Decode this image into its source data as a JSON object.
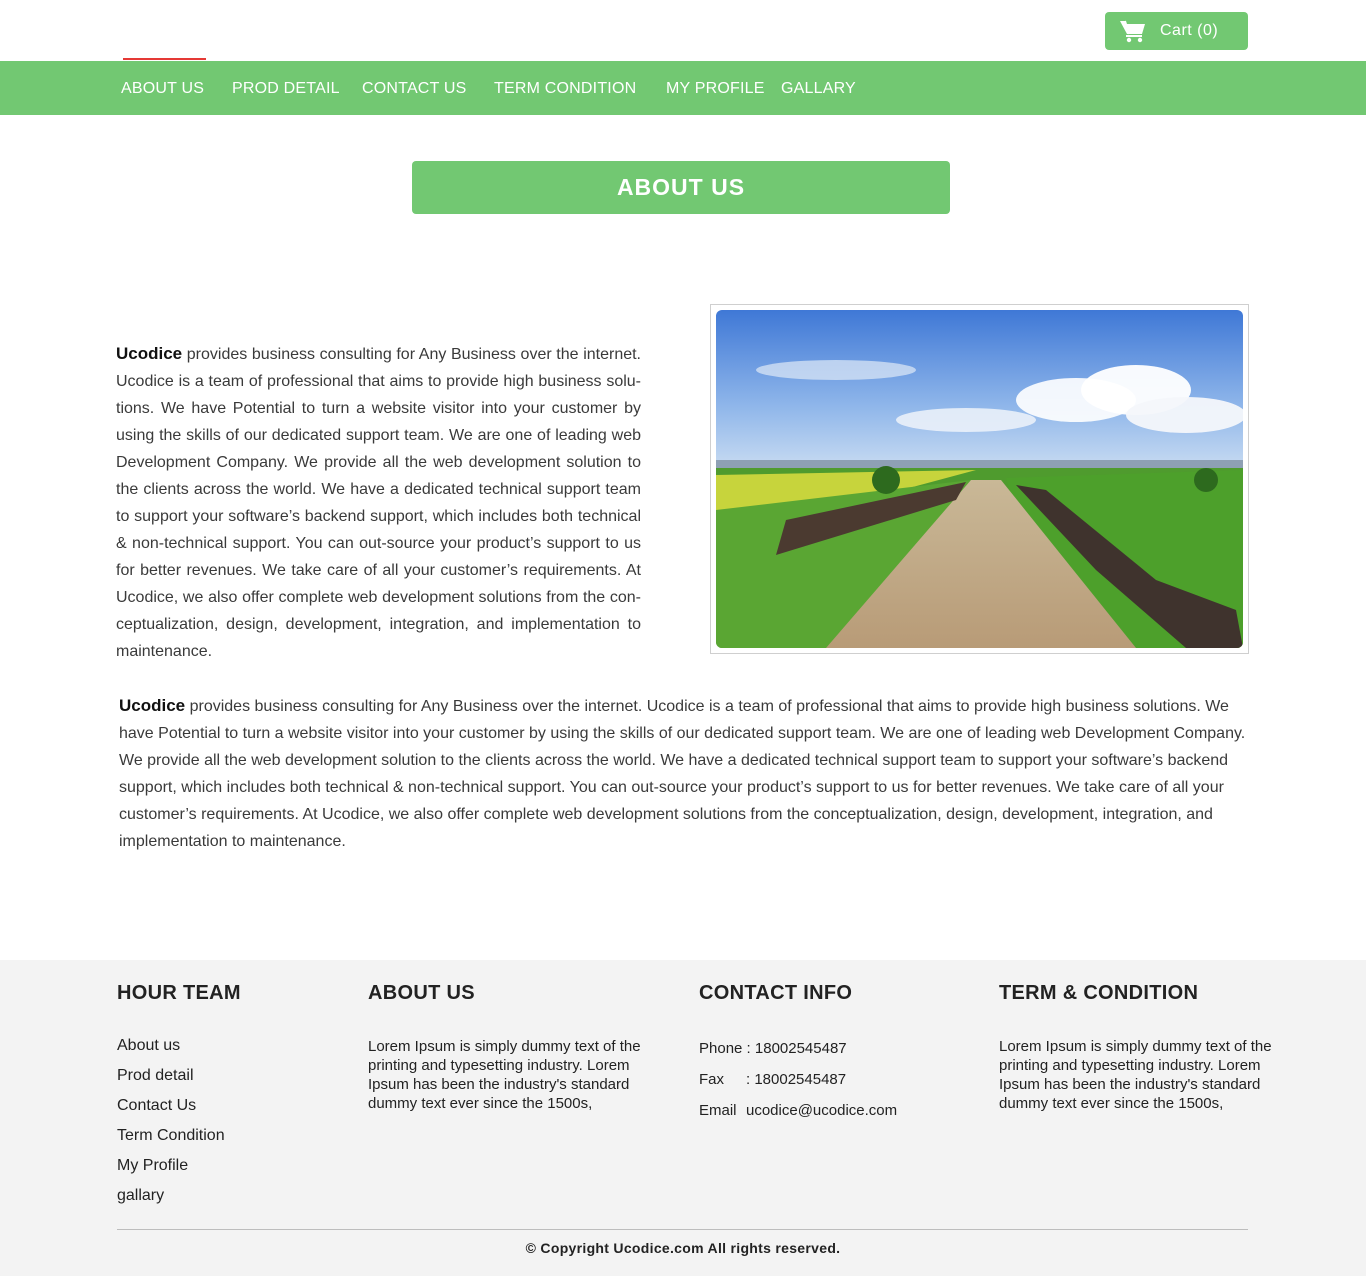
{
  "header": {
    "cart_label": "Cart (0)"
  },
  "nav": {
    "items": [
      "ABOUT US",
      "PROD DETAIL",
      "CONTACT US",
      "TERM CONDITION",
      "MY PROFILE",
      "GALLARY"
    ],
    "active_index": 0
  },
  "page": {
    "heading": "ABOUT US"
  },
  "content": {
    "brand": "Ucodice",
    "paragraph1": " provides business consulting for Any Business over the internet. Ucodice is a team of professional that aims to provide high business solu-tions. We have Potential to turn a website visitor into your customer by using the skills of our dedicated support team. We are one of leading web Development Company. We provide all the web development solution to the clients across the world.  We have a dedicated technical support team to support your software’s backend support, which includes both technical & non-technical support.  You can out-source your product’s support to us for better revenues. We take care of all your customer’s requirements.  At Ucodice, we also offer complete web development solutions from the con-ceptualization, design, development, integration, and implementation to maintenance.",
    "paragraph2": " provides business consulting for Any Business over the internet. Ucodice is a team of professional that aims to provide high business solutions. We have Potential to turn a website visitor into your customer by using the skills of our dedicated support team. We are one of leading web Development Company. We provide all the web development solution to the clients across the world.  We have a dedicated technical support team to support your software’s backend support, which includes both technical & non-technical support.  You can out-source your product’s support to us for better revenues. We take care of all your customer’s requirements.  At Ucodice, we also offer complete web development solutions from the conceptualization, design, development, integration, and implementation to maintenance."
  },
  "footer": {
    "team": {
      "title": "HOUR TEAM",
      "links": [
        "About us",
        "Prod detail",
        "Contact Us",
        "Term Condition",
        "My Profile",
        "gallary"
      ]
    },
    "about": {
      "title": "ABOUT US",
      "text": "Lorem Ipsum is simply dummy text of the printing and typesetting industry. Lorem Ipsum has been the industry's standard dummy text ever since the 1500s,"
    },
    "contact": {
      "title": "CONTACT INFO",
      "phone_label": "Phone",
      "phone": ": 18002545487",
      "fax_label": "Fax",
      "fax": ": 18002545487",
      "email_label": "Email",
      "email": "ucodice@ucodice.com"
    },
    "terms": {
      "title": "TERM & CONDITION",
      "text": "Lorem Ipsum is simply dummy text of the printing and typesetting industry. Lorem Ipsum has been the industry's standard dummy text ever since the 1500s,"
    },
    "copyright": "© Copyright Ucodice.com All rights reserved."
  },
  "colors": {
    "brand_green": "#72c872",
    "active_red": "#e53935",
    "footer_bg": "#f3f3f3"
  }
}
